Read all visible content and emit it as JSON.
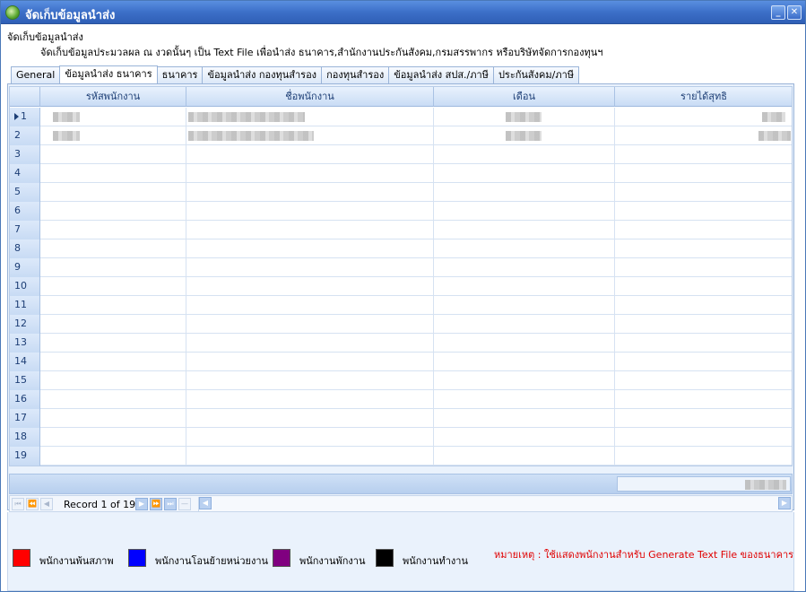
{
  "window": {
    "title": "จัดเก็บข้อมูลนำส่ง"
  },
  "page": {
    "heading": "จัดเก็บข้อมูลนำส่ง",
    "description": "จัดเก็บข้อมูลประมวลผล ณ งวดนั้นๆ เป็น Text File เพื่อนำส่ง ธนาคาร,สำนักงานประกันสังคม,กรมสรรพากร หรือบริษัทจัดการกองทุนฯ"
  },
  "tabs": [
    {
      "label": "General"
    },
    {
      "label": "ข้อมูลนำส่ง ธนาคาร",
      "active": true
    },
    {
      "label": "ธนาคาร"
    },
    {
      "label": "ข้อมูลนำส่ง กองทุนสำรอง"
    },
    {
      "label": "กองทุนสำรอง"
    },
    {
      "label": "ข้อมูลนำส่ง สปส./ภาษี"
    },
    {
      "label": "ประกันสังคม/ภาษี"
    }
  ],
  "grid": {
    "columns": [
      "รหัสพนักงาน",
      "ชื่อพนักงาน",
      "เดือน",
      "รายได้สุทธิ"
    ],
    "row_numbers": [
      "1",
      "2",
      "3",
      "4",
      "5",
      "6",
      "7",
      "8",
      "9",
      "10",
      "11",
      "12",
      "13",
      "14",
      "15",
      "16",
      "17",
      "18",
      "19"
    ],
    "current_row": 1
  },
  "navigator": {
    "record_text": "Record 1 of 19"
  },
  "legend": {
    "items": [
      {
        "label": "พนักงานพ้นสภาพ",
        "color": "#ff0000"
      },
      {
        "label": "พนักงานโอนย้ายหน่วยงาน",
        "color": "#0000ff"
      },
      {
        "label": "พนักงานพักงาน",
        "color": "#800080"
      },
      {
        "label": "พนักงานทำงาน",
        "color": "#000000"
      }
    ],
    "note": "หมายเหตุ : ใช้แสดงพนักงานสำหรับ Generate Text File ของธนาคาร"
  },
  "colors": {
    "title_bar": "#3c6fc8",
    "panel_bg": "#eaf2fc",
    "note_text": "#e00000"
  }
}
